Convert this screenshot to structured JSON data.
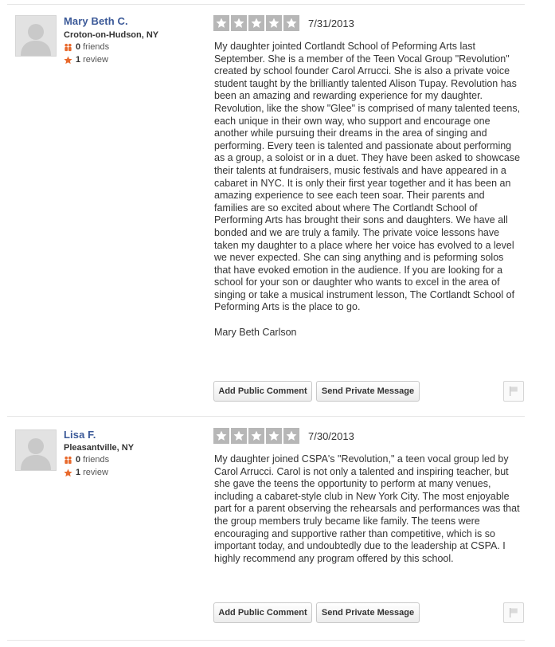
{
  "reviews": [
    {
      "user": {
        "name": "Mary Beth C.",
        "location": "Croton-on-Hudson, NY",
        "friends_count": "0",
        "friends_label": "friends",
        "reviews_count": "1",
        "reviews_label": "review"
      },
      "rating": 5,
      "date": "7/31/2013",
      "text": "My daughter jointed Cortlandt School of Peforming Arts last September.  She is a member of the Teen Vocal Group \"Revolution\" created by school founder Carol Arrucci.  She is also a private voice student taught by the brilliantly talented Alison Tupay.  Revolution has been an amazing and rewarding experience for my daughter.  Revolution, like the show \"Glee\" is comprised of many talented teens, each unique in their own way, who support and encourage one another while pursuing their dreams in the area of singing and performing.   Every teen is talented and passionate about performing as a group, a soloist or in a duet.  They have been asked to showcase their talents at fundraisers, music festivals and have appeared in a cabaret in NYC.  It is only their first year together and it has been an amazing experience to see each teen soar.  Their parents and families are so excited about where The Cortlandt School of Performing Arts has brought their sons and daughters.  We have all bonded and we are truly a family.  The private voice lessons have taken my daughter to a place where her voice has evolved to a level we never expected.  She can sing anything and is peforming solos that have evoked emotion in the audience.  If you are looking for a school for your son or daughter who wants to excel in the area of singing or take a musical instrument lesson, The Cortlandt School of Peforming Arts is the place to go.",
      "signature": "Mary Beth Carlson",
      "buttons": {
        "comment": "Add Public Comment",
        "message": "Send Private Message"
      },
      "icons": {
        "flag": "flag-icon"
      }
    },
    {
      "user": {
        "name": "Lisa F.",
        "location": "Pleasantville, NY",
        "friends_count": "0",
        "friends_label": "friends",
        "reviews_count": "1",
        "reviews_label": "review"
      },
      "rating": 5,
      "date": "7/30/2013",
      "text": "My daughter joined CSPA's \"Revolution,\" a teen vocal group led by Carol Arrucci.  Carol is not only a talented and inspiring teacher, but she gave the teens the opportunity to perform at many venues, including a cabaret-style club in New York City.  The most enjoyable part for a parent observing the rehearsals and performances was that the group members truly became like family.  The teens were encouraging and supportive rather than competitive, which is so important today, and undoubtedly due to the leadership at CSPA.  I highly recommend any program offered by this school.",
      "signature": "",
      "buttons": {
        "comment": "Add Public Comment",
        "message": "Send Private Message"
      },
      "icons": {
        "flag": "flag-icon"
      }
    }
  ],
  "colors": {
    "username": "#3b5998",
    "star_box": "#b7b7b7",
    "friends_icon": "#e8692c",
    "review_icon": "#e8692c"
  }
}
